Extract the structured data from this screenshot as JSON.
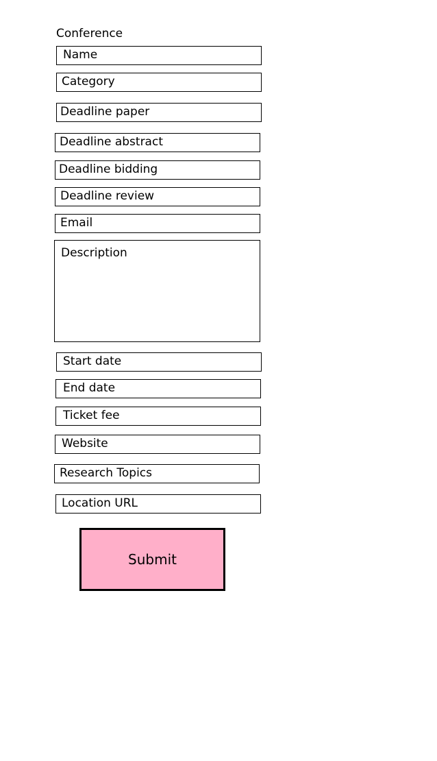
{
  "form": {
    "title": "Conference",
    "fields": {
      "name": "Name",
      "category": "Category",
      "deadline_paper": "Deadline paper",
      "deadline_abstract": "Deadline abstract",
      "deadline_bidding": "Deadline bidding",
      "deadline_review": "Deadline review",
      "email": "Email",
      "description": "Description",
      "start_date": "Start date",
      "end_date": "End date",
      "ticket_fee": "Ticket fee",
      "website": "Website",
      "research_topics": "Research Topics",
      "location_url": "Location URL"
    },
    "submit_label": "Submit"
  },
  "colors": {
    "submit_background": "#ffafc9",
    "border": "#000000",
    "background": "#ffffff"
  }
}
